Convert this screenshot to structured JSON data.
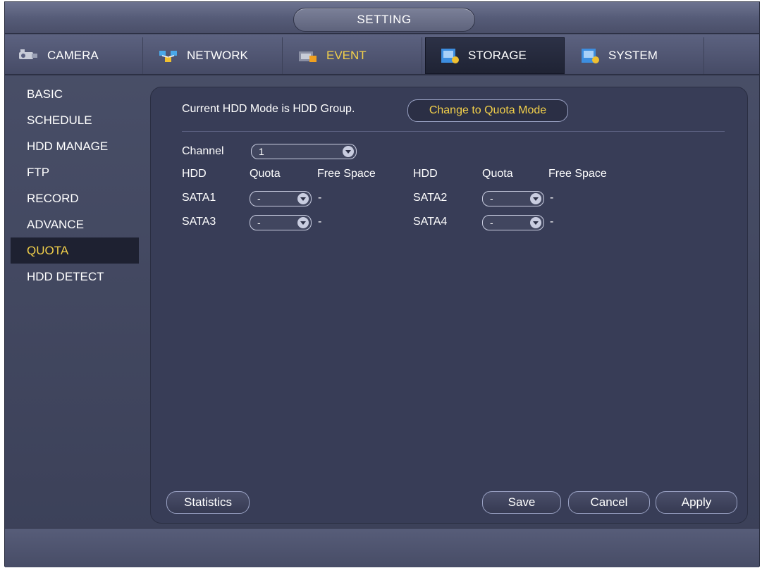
{
  "title": "SETTING",
  "tabs": [
    {
      "label": "CAMERA",
      "icon": "camera-icon"
    },
    {
      "label": "NETWORK",
      "icon": "network-icon"
    },
    {
      "label": "EVENT",
      "icon": "event-icon"
    },
    {
      "label": "STORAGE",
      "icon": "storage-icon"
    },
    {
      "label": "SYSTEM",
      "icon": "system-icon"
    }
  ],
  "active_tab": "STORAGE",
  "sidebar": {
    "items": [
      "BASIC",
      "SCHEDULE",
      "HDD MANAGE",
      "FTP",
      "RECORD",
      "ADVANCE",
      "QUOTA",
      "HDD DETECT"
    ],
    "active": "QUOTA"
  },
  "panel": {
    "mode_text": "Current HDD Mode is HDD Group.",
    "change_mode_label": "Change to Quota Mode",
    "channel_label": "Channel",
    "channel_value": "1",
    "headers": {
      "hdd": "HDD",
      "quota": "Quota",
      "free_space": "Free Space"
    },
    "disks": [
      {
        "name": "SATA1",
        "quota": "-",
        "free": "-"
      },
      {
        "name": "SATA2",
        "quota": "-",
        "free": "-"
      },
      {
        "name": "SATA3",
        "quota": "-",
        "free": "-"
      },
      {
        "name": "SATA4",
        "quota": "-",
        "free": "-"
      }
    ],
    "buttons": {
      "statistics": "Statistics",
      "save": "Save",
      "cancel": "Cancel",
      "apply": "Apply"
    }
  },
  "colors": {
    "accent_yellow": "#f2d04a",
    "panel_bg": "#383d57",
    "window_bg": "#4a5069"
  }
}
